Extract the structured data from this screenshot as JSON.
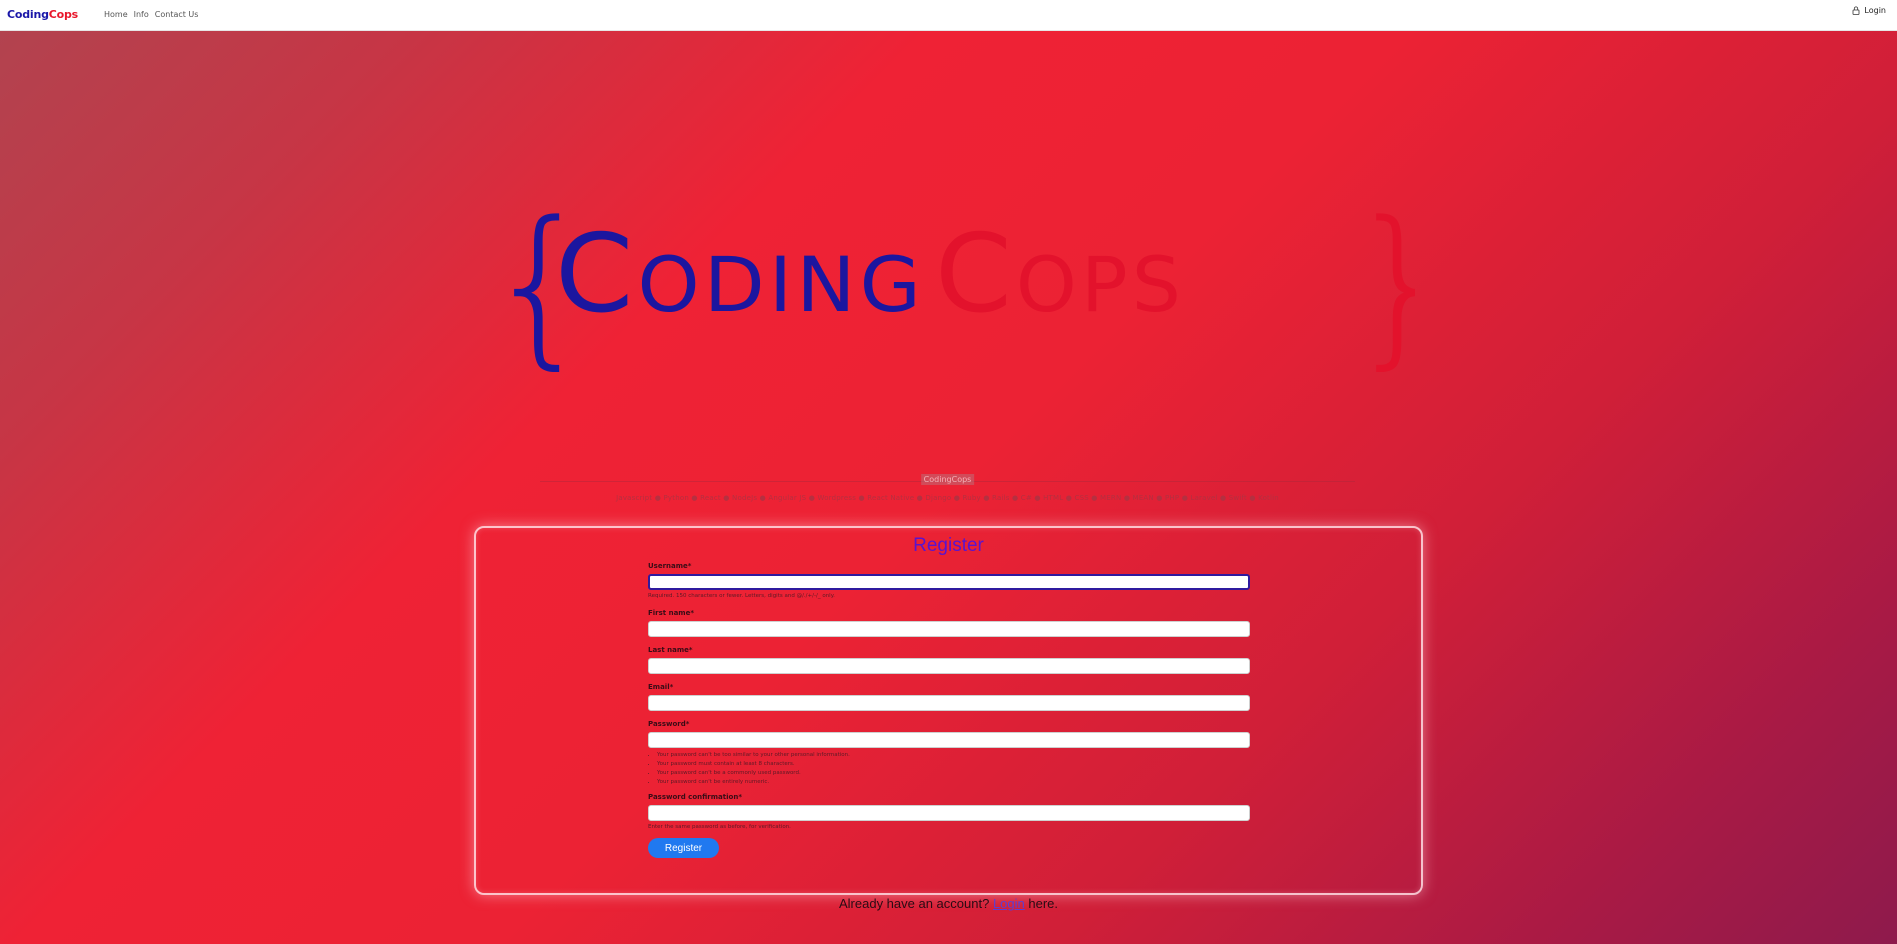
{
  "navbar": {
    "brand_part1": "Coding",
    "brand_part2": "Cops",
    "links": [
      "Home",
      "Info",
      "Contact Us"
    ],
    "login_label": "Login",
    "login_icon": "lock-icon"
  },
  "hero": {
    "logo_open_brace": "{",
    "logo_part1": "Coding",
    "logo_part2": "Cops",
    "logo_close_brace": "}",
    "divider_label": "CodingCops",
    "tech_list": "Javascript ● Python ● React ● NodeJs ● Angular JS ● Wordpress ● React Native ● Django ● Ruby ● Rails ● C# ● HTML ● CSS ● MERN ● MEAN ● PHP ● Laravel ● Swift ● Kotlin"
  },
  "register": {
    "title": "Register",
    "fields": {
      "username": {
        "label": "Username*",
        "value": "",
        "help": "Required. 150 characters or fewer. Letters, digits and @/./+/-/_ only."
      },
      "first_name": {
        "label": "First name*",
        "value": ""
      },
      "last_name": {
        "label": "Last name*",
        "value": ""
      },
      "email": {
        "label": "Email*",
        "value": ""
      },
      "password": {
        "label": "Password*",
        "value": "",
        "help": [
          "Your password can't be too similar to your other personal information.",
          "Your password must contain at least 8 characters.",
          "Your password can't be a commonly used password.",
          "Your password can't be entirely numeric."
        ]
      },
      "password_confirmation": {
        "label": "Password confirmation*",
        "value": "",
        "help": "Enter the same password as before, for verification."
      }
    },
    "submit_label": "Register"
  },
  "footer_prompt": {
    "prefix": "Already have an account?",
    "link": "Login",
    "suffix": "here."
  },
  "colors": {
    "brand_blue": "#1a17a8",
    "brand_red": "#e8162a",
    "button_blue": "#2079f0",
    "title_purple": "#5a14cf"
  }
}
